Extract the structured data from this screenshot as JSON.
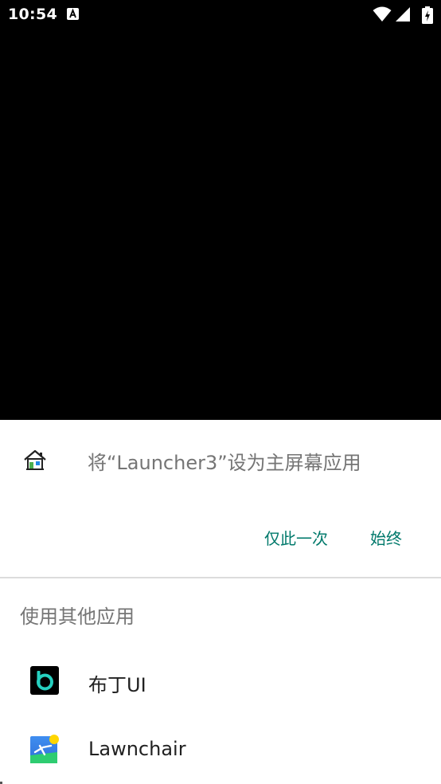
{
  "status_bar": {
    "time": "10:54",
    "notification_icon": "accessibility-a-icon",
    "icons": [
      "wifi-icon",
      "cell-signal-icon",
      "battery-charging-icon"
    ]
  },
  "dialog": {
    "header_icon": "home-icon",
    "title": "将“Launcher3”设为主屏幕应用",
    "buttons": {
      "just_once": "仅此一次",
      "always": "始终"
    },
    "other_apps_title": "使用其他应用",
    "apps": [
      {
        "label": "布丁UI",
        "icon": "budding-ui-icon"
      },
      {
        "label": "Lawnchair",
        "icon": "lawnchair-icon"
      }
    ]
  },
  "colors": {
    "accent": "#00796b",
    "secondary_text": "#757575",
    "primary_text": "#212121",
    "backdrop": "#000000",
    "sheet": "#ffffff"
  }
}
